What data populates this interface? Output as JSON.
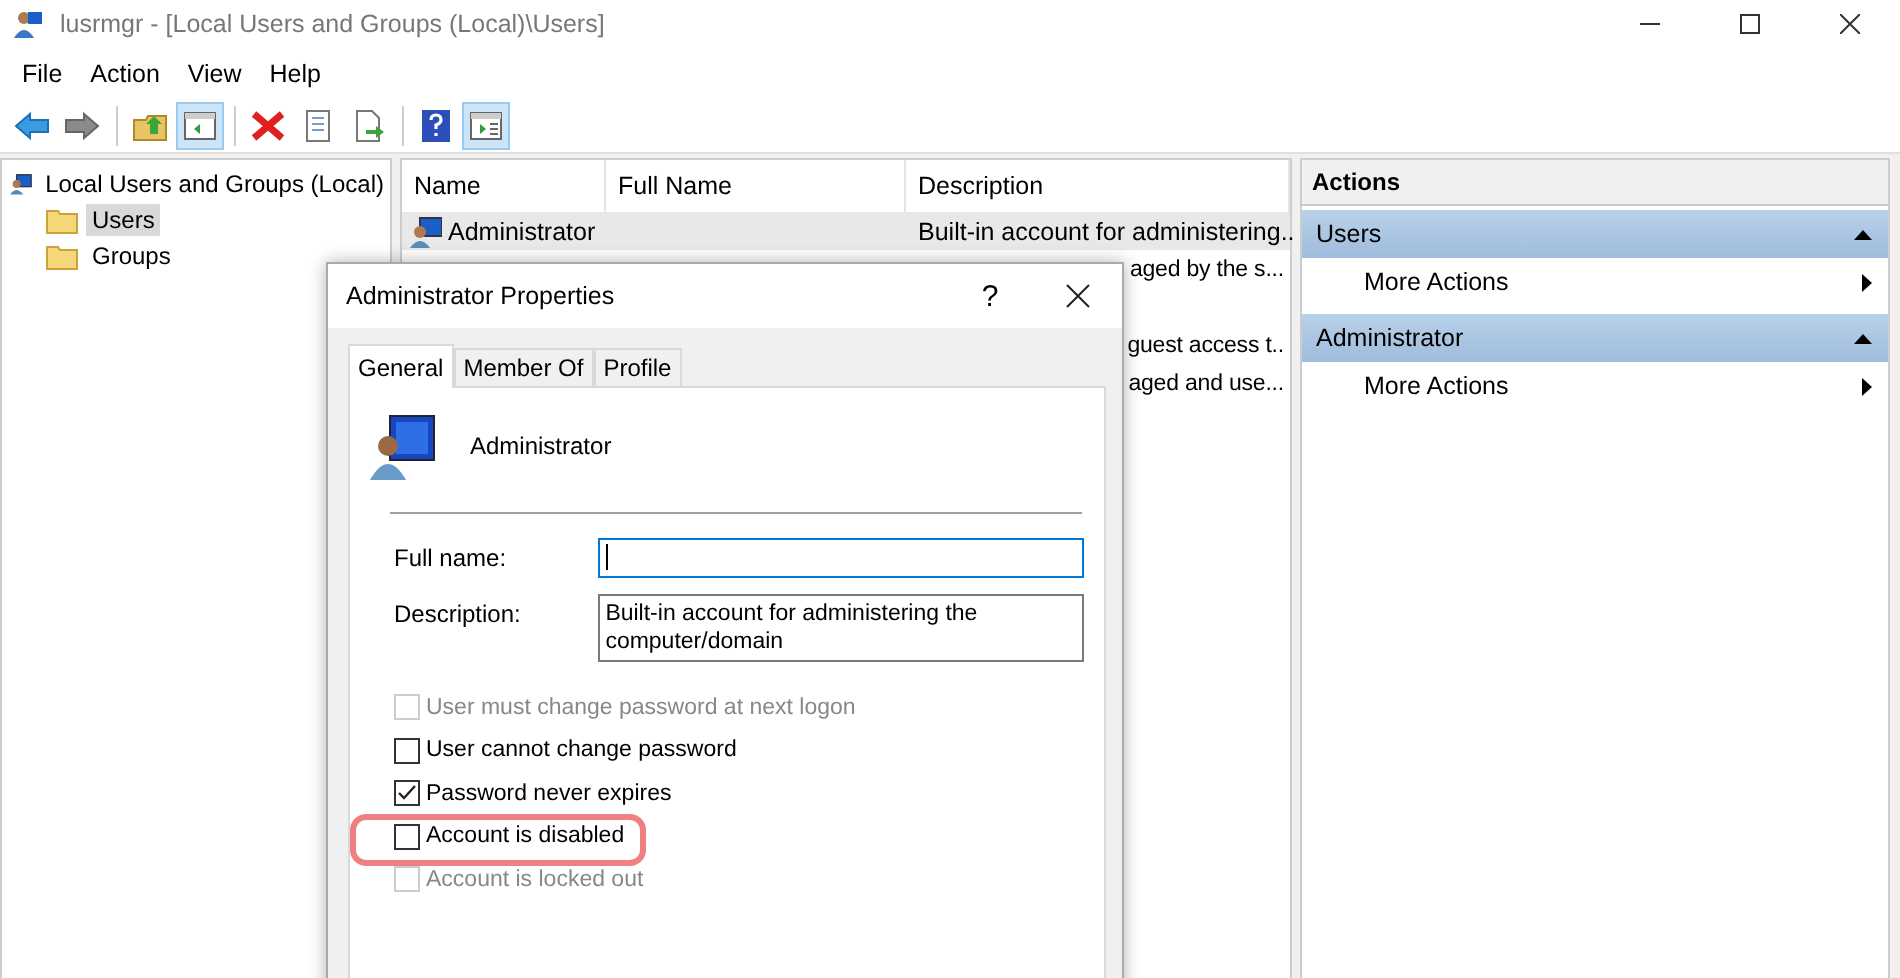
{
  "window": {
    "title": "lusrmgr - [Local Users and Groups (Local)\\Users]"
  },
  "menu": [
    "File",
    "Action",
    "View",
    "Help"
  ],
  "toolbar": [
    {
      "kind": "back",
      "pressed": false
    },
    {
      "kind": "forward",
      "pressed": false
    },
    {
      "kind": "sep"
    },
    {
      "kind": "up",
      "pressed": false
    },
    {
      "kind": "tree",
      "pressed": true
    },
    {
      "kind": "sep"
    },
    {
      "kind": "delete",
      "pressed": false
    },
    {
      "kind": "properties",
      "pressed": false
    },
    {
      "kind": "export",
      "pressed": false
    },
    {
      "kind": "sep"
    },
    {
      "kind": "help",
      "pressed": false
    },
    {
      "kind": "pane",
      "pressed": true
    }
  ],
  "tree": {
    "label": "Local Users and Groups (Local)",
    "children": [
      {
        "label": "Users",
        "selected": true
      },
      {
        "label": "Groups",
        "selected": false
      }
    ]
  },
  "table": {
    "columns": [
      "Name",
      "Full Name",
      "Description"
    ],
    "rows": [
      {
        "name": "Administrator",
        "description": "Built-in account for administering..",
        "selected": true
      },
      {
        "description": "aged by the s...",
        "selected": false
      },
      {
        "selected": false
      },
      {
        "description": "guest access t..",
        "selected": false
      },
      {
        "description": "aged and use...",
        "selected": false
      }
    ]
  },
  "actions": {
    "title": "Actions",
    "sections": [
      {
        "label": "Users",
        "expanded": true,
        "items": [
          "More Actions"
        ]
      },
      {
        "label": "Administrator",
        "expanded": true,
        "items": [
          "More Actions"
        ]
      }
    ]
  },
  "dialog": {
    "title": "Administrator Properties",
    "help": "?",
    "tabs": [
      {
        "label": "General",
        "selected": true
      },
      {
        "label": "Member Of",
        "selected": false
      },
      {
        "label": "Profile",
        "selected": false
      }
    ],
    "user": "Administrator",
    "fields": [
      {
        "label": "Full name:",
        "focused": true
      },
      {
        "label": "Description:",
        "value": "Built-in account for administering the computer/domain",
        "focused": false
      }
    ],
    "checkboxes": [
      {
        "label": "User must change password at next logon",
        "checked": false,
        "disabled": true,
        "highlighted": false
      },
      {
        "label": "User cannot change password",
        "checked": false,
        "disabled": false,
        "highlighted": false
      },
      {
        "label": "Password never expires",
        "checked": true,
        "disabled": false,
        "highlighted": false
      },
      {
        "label": "Account is disabled",
        "checked": false,
        "disabled": false,
        "highlighted": true
      },
      {
        "label": "Account is locked out",
        "checked": false,
        "disabled": true,
        "highlighted": false
      }
    ]
  }
}
